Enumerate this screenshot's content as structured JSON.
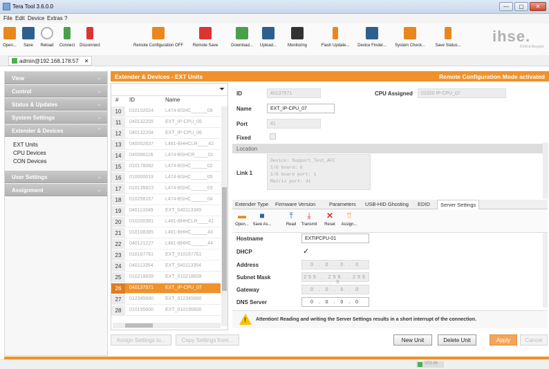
{
  "app": {
    "title": "Tera Tool 3.6.0.0"
  },
  "window_buttons": {
    "minimize": "—",
    "maximize": "▢",
    "close": "✕"
  },
  "menu": [
    "File",
    "Edit",
    "Device",
    "Extras",
    "?"
  ],
  "toolbar": [
    {
      "label": "Open...",
      "icon": "folder-icon",
      "color": "#e8881c"
    },
    {
      "label": "Save",
      "icon": "save-icon",
      "color": "#2d5f8f"
    },
    {
      "label": "Reload",
      "icon": "reload-icon",
      "color": "#b0b0b0"
    },
    {
      "label": "Connect",
      "icon": "connect-icon",
      "color": "#4aa04a"
    },
    {
      "label": "Disconnect",
      "icon": "disconnect-icon",
      "color": "#d33"
    },
    {
      "label": "Remote Configuration OFF",
      "icon": "remote-config-icon",
      "color": "#e8881c"
    },
    {
      "label": "Remote Save",
      "icon": "remote-save-icon",
      "color": "#d33"
    },
    {
      "label": "Download...",
      "icon": "download-icon",
      "color": "#4aa04a"
    },
    {
      "label": "Upload...",
      "icon": "upload-icon",
      "color": "#2d5f8f"
    },
    {
      "label": "Monitoring",
      "icon": "monitoring-icon",
      "color": "#333"
    },
    {
      "label": "Flash Update...",
      "icon": "flash-update-icon",
      "color": "#e8881c"
    },
    {
      "label": "Device Finder...",
      "icon": "device-finder-icon",
      "color": "#2d5f8f"
    },
    {
      "label": "System Check...",
      "icon": "system-check-icon",
      "color": "#e8881c"
    },
    {
      "label": "Save Status...",
      "icon": "save-status-icon",
      "color": "#e8881c"
    }
  ],
  "brand": {
    "logo": "ihse.",
    "sub": "KVM & Beyond"
  },
  "connection": {
    "label": "admin@192.168.178.57",
    "close": "✕"
  },
  "sidebar": {
    "sections": [
      {
        "label": "View",
        "chev": "⌄"
      },
      {
        "label": "Control",
        "chev": "⌄"
      },
      {
        "label": "Status & Updates",
        "chev": "⌄"
      },
      {
        "label": "System Settings",
        "chev": "⌄"
      },
      {
        "label": "Extender & Devices",
        "chev": "⌃"
      }
    ],
    "items": [
      "EXT Units",
      "CPU Devices",
      "CON Devices"
    ],
    "sections2": [
      {
        "label": "User Settings",
        "chev": "⌄"
      },
      {
        "label": "Assignment",
        "chev": "⌄"
      }
    ]
  },
  "main": {
    "title": "Extender & Devices - EXT Units",
    "remote_status": "Remote Configuration Mode activated"
  },
  "table": {
    "headers": [
      "#",
      "ID",
      "Name"
    ],
    "rows": [
      {
        "n": "10",
        "id": "010102024",
        "name": "L474-BSHC______08"
      },
      {
        "n": "11",
        "id": "040132205",
        "name": "EXT_IP-CPU_05"
      },
      {
        "n": "12",
        "id": "040132204",
        "name": "EXT_IP-CPU_06"
      },
      {
        "n": "13",
        "id": "040052637",
        "name": "L481-BHHCLR____42"
      },
      {
        "n": "14",
        "id": "040086116",
        "name": "L474-BSHCR_____01"
      },
      {
        "n": "15",
        "id": "010178082",
        "name": "L474-BSHC______02"
      },
      {
        "n": "16",
        "id": "010000019",
        "name": "L474-BSHC______05"
      },
      {
        "n": "17",
        "id": "010135823",
        "name": "L474-BSHC______03"
      },
      {
        "n": "18",
        "id": "010258167",
        "name": "L474-BSHC______04"
      },
      {
        "n": "19",
        "id": "040113349",
        "name": "EXT_040113349"
      },
      {
        "n": "20",
        "id": "010200381",
        "name": "L481-BHHCLR____41"
      },
      {
        "n": "21",
        "id": "010108385",
        "name": "L481-BHHC______43"
      },
      {
        "n": "22",
        "id": "040121227",
        "name": "L481-BHHC______44"
      },
      {
        "n": "23",
        "id": "010167761",
        "name": "EXT_010167761"
      },
      {
        "n": "24",
        "id": "040113354",
        "name": "EXT_040113354"
      },
      {
        "n": "25",
        "id": "010218839",
        "name": "EXT_010218839"
      },
      {
        "n": "26",
        "id": "040137571",
        "name": "EXT_IP-CPU_07"
      },
      {
        "n": "27",
        "id": "012345680",
        "name": "EXT_012345680"
      },
      {
        "n": "28",
        "id": "010195600",
        "name": "EXT_010195600"
      }
    ],
    "selected_index": 16
  },
  "details": {
    "id_label": "ID",
    "id_value": "40137571",
    "cpu_assigned_label": "CPU Assigned",
    "cpu_assigned_value": "01020 IP-CPU_07",
    "name_label": "Name",
    "name_value": "EXT_IP-CPU_07",
    "port_label": "Port",
    "port_value": "41",
    "fixed_label": "Fixed",
    "location_label": "Location",
    "link_label": "Link 1",
    "link_info": [
      "Device: Support_Test_AFC",
      "I/O board:       6",
      "I/O board port: 1",
      "Matrix port:    41"
    ]
  },
  "tabs": [
    "Extender Type",
    "Firmware Version",
    "Parameters",
    "USB-HID Ghosting",
    "EDID",
    "Server Settings"
  ],
  "subtoolbar": [
    {
      "label": "Open...",
      "glyph": "📂",
      "color": "#e8881c"
    },
    {
      "label": "Save As...",
      "glyph": "💾",
      "color": "#2d5f8f"
    },
    {
      "label": "Read",
      "glyph": "⤒",
      "color": "#2d5f8f"
    },
    {
      "label": "Transmit",
      "glyph": "⤓",
      "color": "#d33"
    },
    {
      "label": "Reset",
      "glyph": "✕",
      "color": "#d33"
    },
    {
      "label": "Assign...",
      "glyph": "⫪",
      "color": "#e8881c"
    }
  ],
  "server": {
    "hostname_label": "Hostname",
    "hostname_value": "EXTIPCPU-01",
    "dhcp_label": "DHCP",
    "dhcp_check": "✓",
    "address_label": "Address",
    "address_value": "0 . 0 . 0 . 0",
    "subnet_label": "Subnet Mask",
    "subnet_value": "255 . 255 . 255 . 0",
    "gateway_label": "Gateway",
    "gateway_value": "0 . 0 . 0 . 0",
    "dns_label": "DNS Server",
    "dns_value": "0 . 0 . 0 . 0"
  },
  "warning": {
    "icon": "!",
    "text": "Attention! Reading and writing the Server Settings results in a short interrupt of the connection."
  },
  "buttons": {
    "assign": "Assign Settings to...",
    "copy": "Copy Settings from...",
    "new_unit": "New Unit",
    "delete_unit": "Delete Unit",
    "apply": "Apply",
    "cancel": "Cancel"
  },
  "status": {
    "value": "V03.96"
  },
  "colors": {
    "accent": "#f0922b",
    "header_gray": "#b3b3b3"
  }
}
